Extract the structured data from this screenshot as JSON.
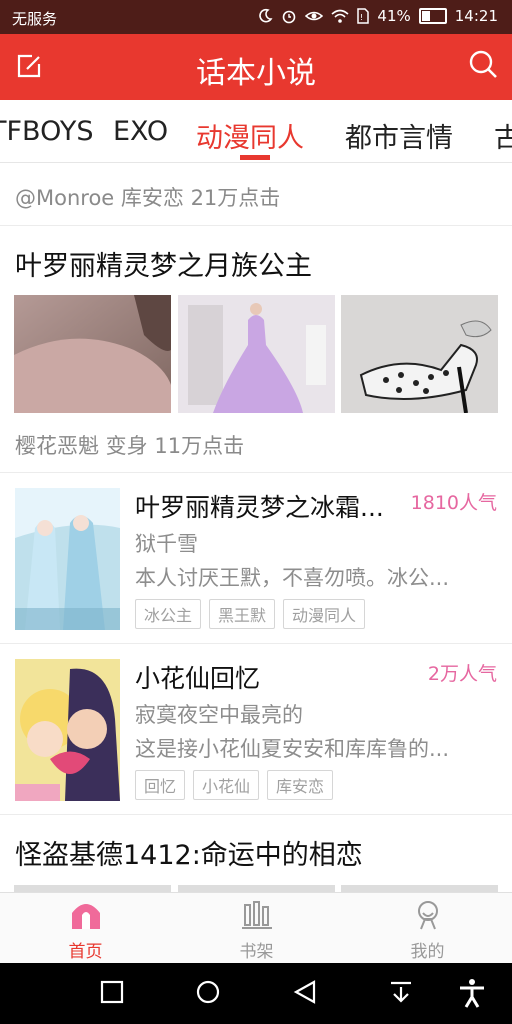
{
  "status": {
    "carrier": "无服务",
    "battery": "41%",
    "battery_level": 0.41,
    "time": "14:21"
  },
  "header": {
    "title": "话本小说",
    "edit_icon": "edit-icon",
    "search_icon": "search-icon",
    "accent": "#e8382f"
  },
  "tabs": [
    {
      "label": "TFBOYS"
    },
    {
      "label": "EXO"
    },
    {
      "label": "动漫同人"
    },
    {
      "label": "都市言情"
    },
    {
      "label": "古"
    }
  ],
  "feed": {
    "item0_meta": "@Monroe  库安恋  21万点击",
    "article1": {
      "title": "叶罗丽精灵梦之月族公主",
      "meta": "樱花恶魁  变身  11万点击"
    },
    "book1": {
      "title": "叶罗丽精灵梦之冰霜...",
      "author": "狱千雪",
      "desc": "本人讨厌王默，不喜勿喷。冰公...",
      "popularity": "1810人气",
      "tags": [
        "冰公主",
        "黑王默",
        "动漫同人"
      ]
    },
    "book2": {
      "title": "小花仙回忆",
      "author": "寂寞夜空中最亮的",
      "desc": "这是接小花仙夏安安和库库鲁的...",
      "popularity": "2万人气",
      "tags": [
        "回忆",
        "小花仙",
        "库安恋"
      ]
    },
    "article2": {
      "title": "怪盗基德1412:命运中的相恋"
    }
  },
  "bottom_nav": [
    {
      "label": "首页",
      "icon": "home-icon"
    },
    {
      "label": "书架",
      "icon": "bookshelf-icon"
    },
    {
      "label": "我的",
      "icon": "profile-icon"
    }
  ]
}
